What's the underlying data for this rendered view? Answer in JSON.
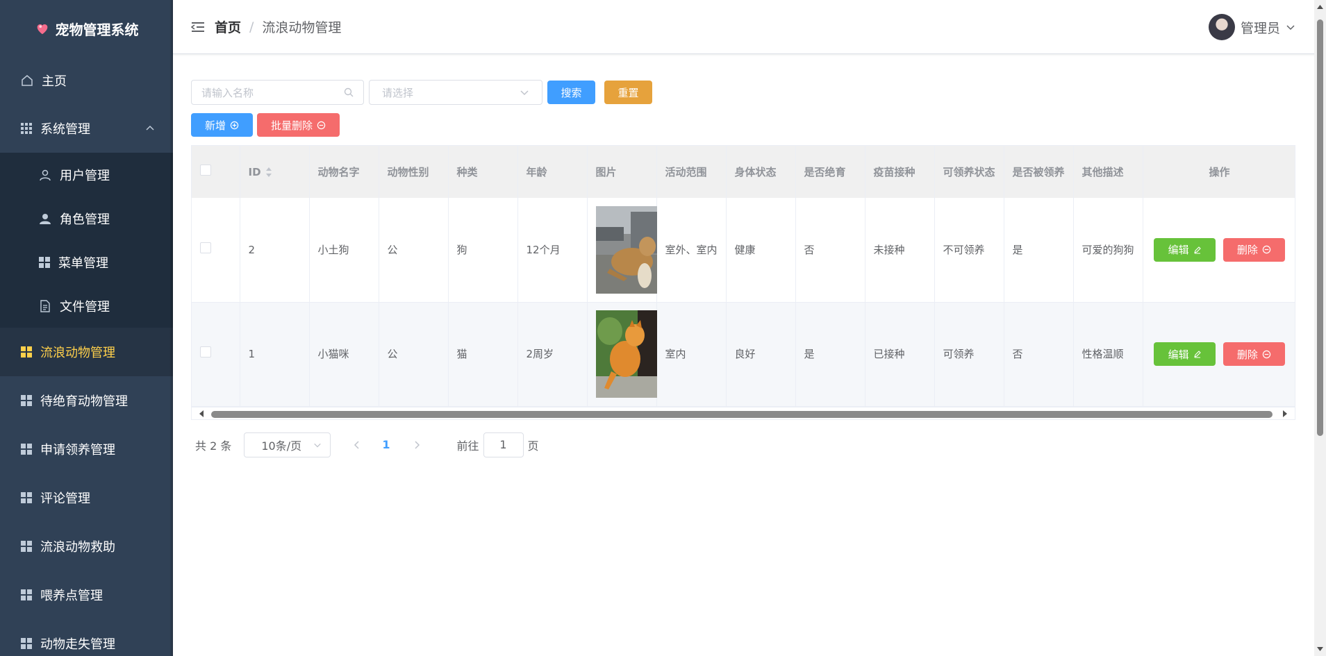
{
  "app": {
    "title": "宠物管理系统"
  },
  "sidebar": {
    "items": [
      {
        "label": "主页"
      },
      {
        "label": "系统管理"
      },
      {
        "label": "用户管理"
      },
      {
        "label": "角色管理"
      },
      {
        "label": "菜单管理"
      },
      {
        "label": "文件管理"
      },
      {
        "label": "流浪动物管理"
      },
      {
        "label": "待绝育动物管理"
      },
      {
        "label": "申请领养管理"
      },
      {
        "label": "评论管理"
      },
      {
        "label": "流浪动物救助"
      },
      {
        "label": "喂养点管理"
      },
      {
        "label": "动物走失管理"
      }
    ],
    "active_color": "#ffd04b",
    "bg_color": "#304156"
  },
  "header": {
    "breadcrumb_home": "首页",
    "breadcrumb_sep": "/",
    "breadcrumb_current": "流浪动物管理",
    "user_name": "管理员"
  },
  "filters": {
    "name_placeholder": "请输入名称",
    "select_placeholder": "请选择",
    "search_label": "搜索",
    "reset_label": "重置"
  },
  "actions": {
    "add_label": "新增",
    "batch_delete_label": "批量删除"
  },
  "table": {
    "headers": [
      "ID",
      "动物名字",
      "动物性别",
      "种类",
      "年龄",
      "图片",
      "活动范围",
      "身体状态",
      "是否绝育",
      "疫苗接种",
      "可领养状态",
      "是否被领养",
      "其他描述",
      "操作"
    ],
    "rows": [
      {
        "id": "2",
        "name": "小土狗",
        "gender": "公",
        "species": "狗",
        "age": "12个月",
        "range": "室外、室内",
        "health": "健康",
        "sterilized": "否",
        "vaccine": "未接种",
        "adoptable": "不可领养",
        "adopted": "是",
        "desc": "可爱的狗狗",
        "image": "dog-photo"
      },
      {
        "id": "1",
        "name": "小猫咪",
        "gender": "公",
        "species": "猫",
        "age": "2周岁",
        "range": "室内",
        "health": "良好",
        "sterilized": "是",
        "vaccine": "已接种",
        "adoptable": "可领养",
        "adopted": "否",
        "desc": "性格温顺",
        "image": "cat-photo"
      }
    ],
    "edit_label": "编辑",
    "delete_label": "删除"
  },
  "pagination": {
    "total": "共 2 条",
    "page_size": "10条/页",
    "current_page": "1",
    "goto_prefix": "前往",
    "goto_value": "1",
    "goto_suffix": "页"
  }
}
